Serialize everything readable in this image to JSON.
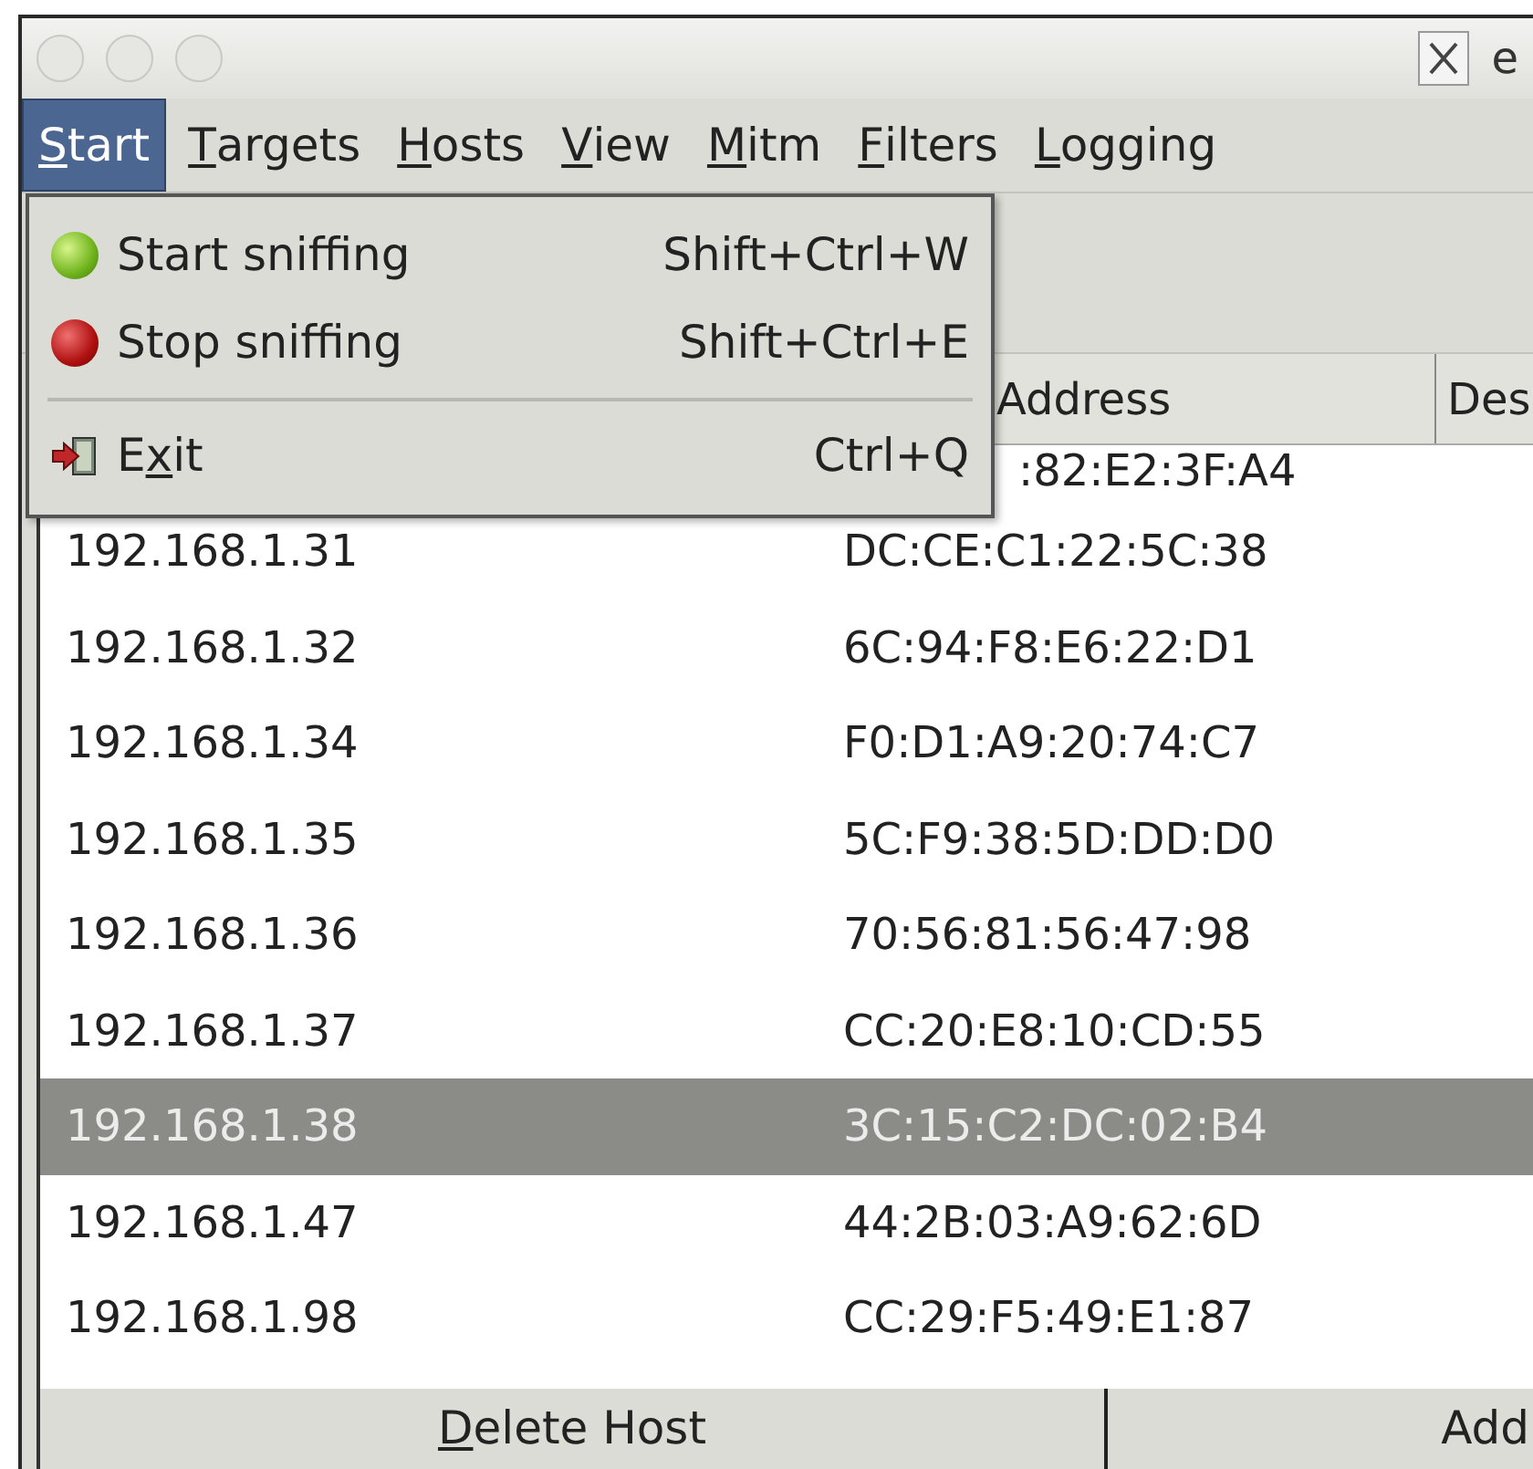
{
  "window": {
    "title": "e"
  },
  "menubar": [
    {
      "key": "S",
      "post": "tart",
      "selected": true
    },
    {
      "key": "T",
      "post": "argets",
      "selected": false
    },
    {
      "key": "H",
      "post": "osts",
      "selected": false
    },
    {
      "key": "V",
      "post": "iew",
      "selected": false
    },
    {
      "key": "M",
      "post": "itm",
      "selected": false
    },
    {
      "key": "F",
      "post": "ilters",
      "selected": false
    },
    {
      "key": "L",
      "post": "ogging",
      "selected": false
    }
  ],
  "dropdown": [
    {
      "kind": "start",
      "pre": "Start sniffing",
      "shortcut": "Shift+Ctrl+W"
    },
    {
      "kind": "stop",
      "pre": "Stop sniffing",
      "shortcut": "Shift+Ctrl+E"
    },
    {
      "kind": "separator"
    },
    {
      "kind": "exit",
      "pre": "E",
      "key": "x",
      "post": "it",
      "shortcut": "Ctrl+Q"
    }
  ],
  "table": {
    "columns": [
      "Address",
      "Des"
    ],
    "rows": [
      {
        "mac": ":82:E2:3F:A4",
        "selected": false
      },
      {
        "ip": "192.168.1.31",
        "mac": "DC:CE:C1:22:5C:38",
        "selected": false
      },
      {
        "ip": "192.168.1.32",
        "mac": "6C:94:F8:E6:22:D1",
        "selected": false
      },
      {
        "ip": "192.168.1.34",
        "mac": "F0:D1:A9:20:74:C7",
        "selected": false
      },
      {
        "ip": "192.168.1.35",
        "mac": "5C:F9:38:5D:DD:D0",
        "selected": false
      },
      {
        "ip": "192.168.1.36",
        "mac": "70:56:81:56:47:98",
        "selected": false
      },
      {
        "ip": "192.168.1.37",
        "mac": "CC:20:E8:10:CD:55",
        "selected": false
      },
      {
        "ip": "192.168.1.38",
        "mac": "3C:15:C2:DC:02:B4",
        "selected": true
      },
      {
        "ip": "192.168.1.47",
        "mac": "44:2B:03:A9:62:6D",
        "selected": false
      },
      {
        "ip": "192.168.1.98",
        "mac": "CC:29:F5:49:E1:87",
        "selected": false
      }
    ]
  },
  "buttons": [
    {
      "key": "D",
      "post": "elete Host"
    },
    {
      "pre": "Add"
    }
  ]
}
